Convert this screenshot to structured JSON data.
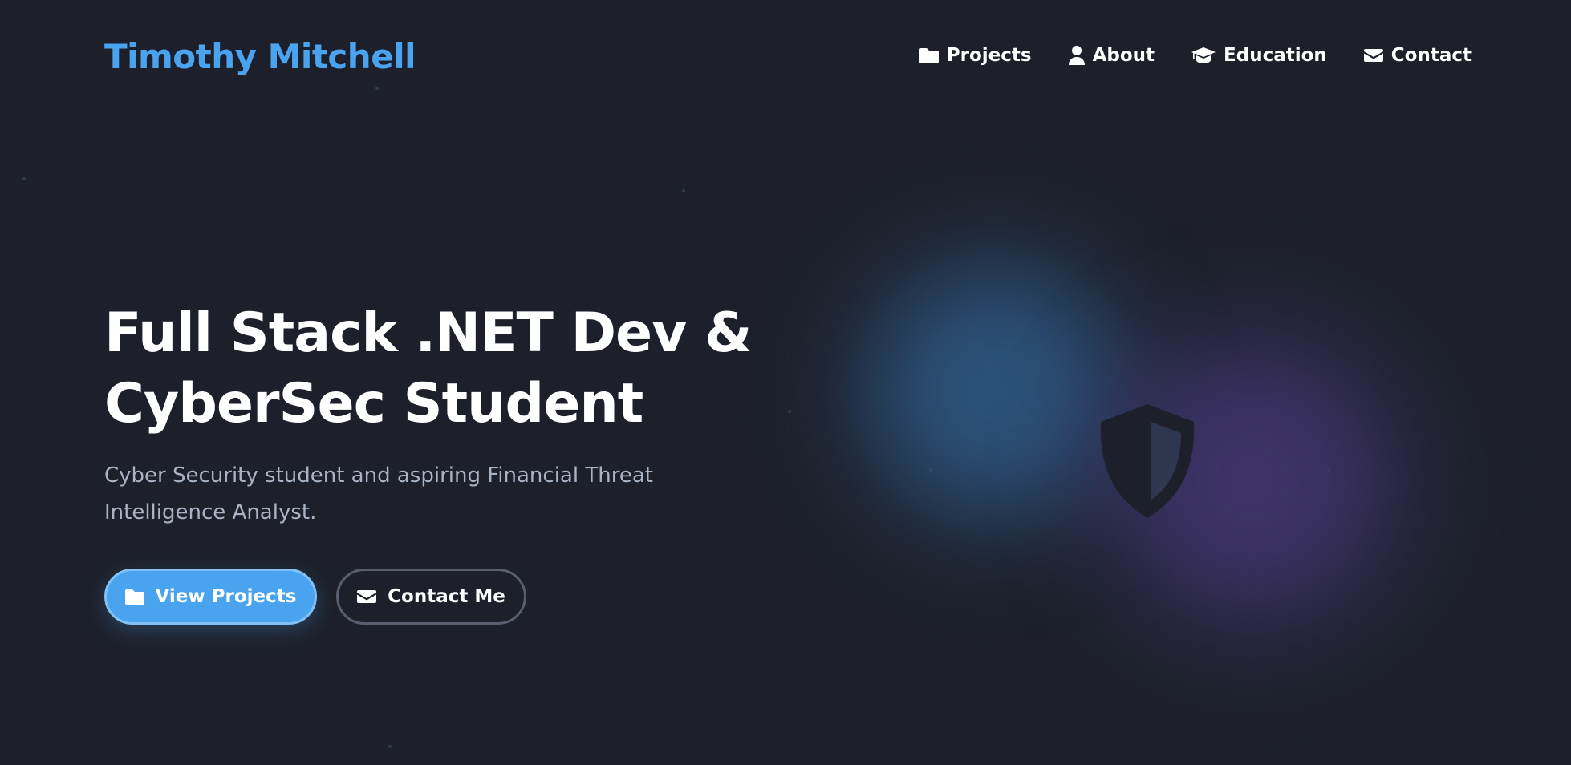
{
  "header": {
    "brand": "Timothy Mitchell",
    "nav": [
      {
        "label": "Projects",
        "icon": "folder-icon"
      },
      {
        "label": "About",
        "icon": "user-icon"
      },
      {
        "label": "Education",
        "icon": "graduation-cap-icon"
      },
      {
        "label": "Contact",
        "icon": "envelope-icon"
      }
    ]
  },
  "hero": {
    "title_line1": "Full Stack .NET Dev &",
    "title_line2": "CyberSec Student",
    "subtitle": "Cyber Security student and aspiring Financial Threat Intelligence Analyst.",
    "primary_button": {
      "label": "View Projects",
      "icon": "folder-icon"
    },
    "secondary_button": {
      "label": "Contact Me",
      "icon": "envelope-icon"
    },
    "graphic_icon": "shield-icon"
  },
  "colors": {
    "background": "#1d202b",
    "accent": "#4aa3ef",
    "text": "#ffffff",
    "muted_text": "#aab3c6",
    "blob_blue": "#315f8e",
    "blob_purple": "#483a7a"
  }
}
